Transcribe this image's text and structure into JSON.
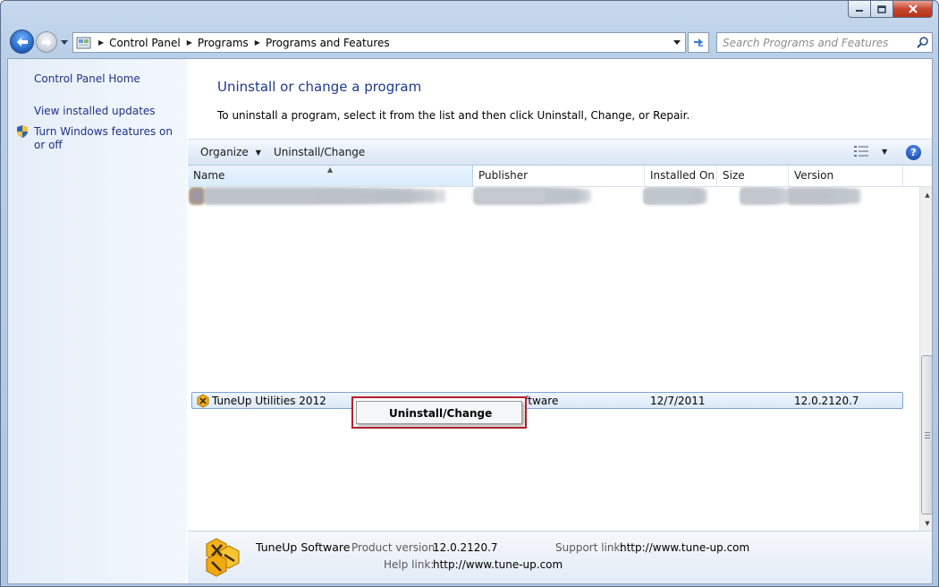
{
  "window": {
    "breadcrumbs": [
      "Control Panel",
      "Programs",
      "Programs and Features"
    ],
    "search_placeholder": "Search Programs and Features"
  },
  "sidebar": {
    "home": "Control Panel Home",
    "updates": "View installed updates",
    "features": "Turn Windows features on or off"
  },
  "main": {
    "title": "Uninstall or change a program",
    "description": "To uninstall a program, select it from the list and then click Uninstall, Change, or Repair."
  },
  "toolbar": {
    "organize": "Organize",
    "uninstall_change": "Uninstall/Change",
    "help": "?"
  },
  "columns": {
    "name": "Name",
    "publisher": "Publisher",
    "installed_on": "Installed On",
    "size": "Size",
    "version": "Version"
  },
  "selected_row": {
    "name": "TuneUp Utilities 2012",
    "publisher": "...Software",
    "installed_on": "12/7/2011",
    "version": "12.0.2120.7"
  },
  "context_menu": {
    "item": "Uninstall/Change"
  },
  "details": {
    "publisher": "TuneUp Software",
    "product_version_label": "Product version:",
    "product_version": "12.0.2120.7",
    "support_link_label": "Support link:",
    "support_link": "http://www.tune-up.com",
    "help_link_label": "Help link:",
    "help_link": "http://www.tune-up.com"
  },
  "colors": {
    "link": "#1e3287",
    "title": "#1e3a8c",
    "highlight_border": "#b3202e"
  }
}
